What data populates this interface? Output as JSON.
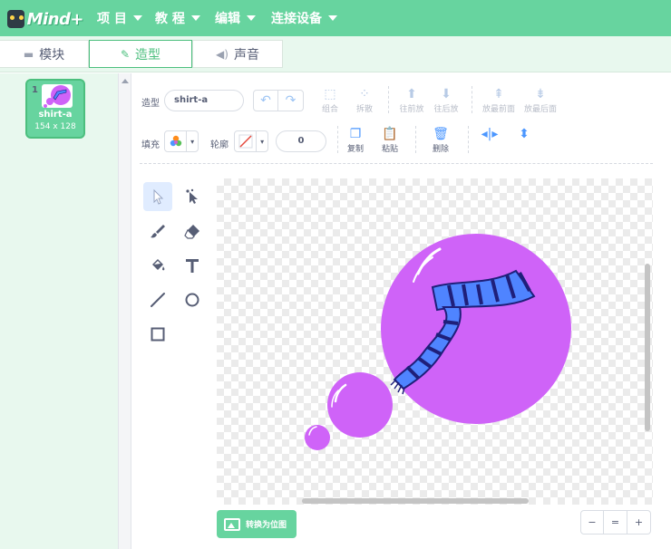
{
  "menubar": {
    "logo_text": "Mind+",
    "items": [
      {
        "label": "项 目"
      },
      {
        "label": "教 程"
      },
      {
        "label": "编辑"
      },
      {
        "label": "连接设备"
      }
    ]
  },
  "tabs": {
    "blocks": "模块",
    "costumes": "造型",
    "sounds": "声音"
  },
  "costumes": [
    {
      "index": "1",
      "name": "shirt-a",
      "size": "154 x 128"
    }
  ],
  "editor": {
    "costume_label": "造型",
    "costume_name": "shirt-a",
    "fill_label": "填充",
    "outline_label": "轮廓",
    "outline_width": "0",
    "buttons": {
      "group": "组合",
      "ungroup": "拆散",
      "forward": "往前放",
      "backward": "往后放",
      "front": "放最前面",
      "back": "放最后面",
      "copy": "复制",
      "paste": "粘贴",
      "delete": "删除"
    },
    "convert_label": "转换为位图",
    "zoom": {
      "out": "−",
      "reset": "=",
      "in": "+"
    }
  },
  "colors": {
    "brand_green": "#67d49f",
    "bubble_purple": "#cf63f8",
    "scarf_blue": "#4f84ff",
    "scarf_dark": "#1f1f7a"
  },
  "icons": {
    "select": "select-arrow-icon",
    "reshape": "reshape-icon",
    "brush": "brush-icon",
    "eraser": "eraser-icon",
    "fill": "fill-bucket-icon",
    "text": "text-icon",
    "line": "line-icon",
    "circle": "circle-icon",
    "rect": "rectangle-icon"
  }
}
